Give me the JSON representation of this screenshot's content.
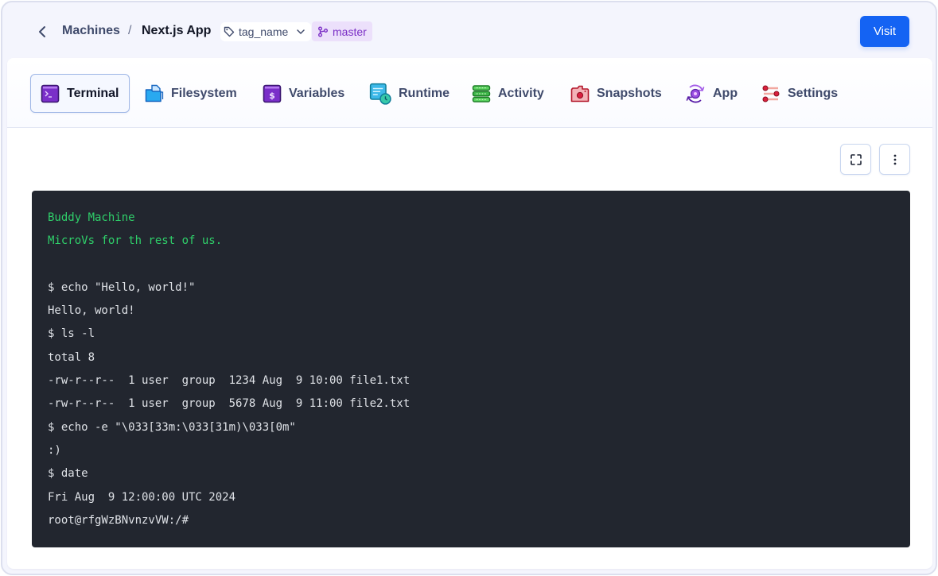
{
  "header": {
    "back_label": "Back",
    "breadcrumb_parent": "Machines",
    "breadcrumb_separator": "/",
    "breadcrumb_current": "Next.js App",
    "tag_select": {
      "value": "tag_name"
    },
    "branch_badge": "master",
    "visit_label": "Visit"
  },
  "tabs": [
    {
      "label": "Terminal",
      "icon": "terminal-icon",
      "active": true
    },
    {
      "label": "Filesystem",
      "icon": "folder-icon",
      "active": false
    },
    {
      "label": "Variables",
      "icon": "dollar-icon",
      "active": false
    },
    {
      "label": "Runtime",
      "icon": "clock-window-icon",
      "active": false
    },
    {
      "label": "Activity",
      "icon": "stack-icon",
      "active": false
    },
    {
      "label": "Snapshots",
      "icon": "camera-icon",
      "active": false
    },
    {
      "label": "App",
      "icon": "refresh-flower-icon",
      "active": false
    },
    {
      "label": "Settings",
      "icon": "sliders-icon",
      "active": false
    }
  ],
  "toolbar": {
    "fullscreen_icon": "fullscreen-icon",
    "more_icon": "more-vertical-icon"
  },
  "terminal": {
    "lines": [
      {
        "text": "Buddy Machine",
        "color": "#2fcf6a"
      },
      {
        "text": "MicroVs for th rest of us.",
        "color": "#2fcf6a"
      },
      {
        "text": ""
      },
      {
        "text": "$ echo \"Hello, world!\""
      },
      {
        "text": "Hello, world!"
      },
      {
        "text": "$ ls -l"
      },
      {
        "text": "total 8"
      },
      {
        "text": "-rw-r--r--  1 user  group  1234 Aug  9 10:00 file1.txt"
      },
      {
        "text": "-rw-r--r--  1 user  group  5678 Aug  9 11:00 file2.txt"
      },
      {
        "text": "$ echo -e \"\\033[33m:\\033[31m)\\033[0m\""
      },
      {
        "text": ":)"
      },
      {
        "text": "$ date"
      },
      {
        "text": "Fri Aug  9 12:00:00 UTC 2024"
      },
      {
        "text": "root@rfgWzBNvnzvVW:/#"
      }
    ]
  },
  "colors": {
    "accent": "#1463f3",
    "branch_badge_bg": "#ece0fb",
    "branch_badge_text": "#7b2fc6",
    "terminal_bg": "#22262f",
    "terminal_green": "#2fcf6a"
  }
}
